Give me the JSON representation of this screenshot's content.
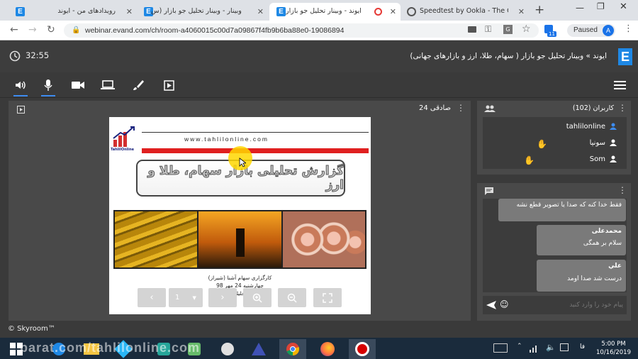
{
  "browser": {
    "tabs": [
      {
        "title": "رویدادهای من - ایوند"
      },
      {
        "title": "وبینار - وبینار تحلیل جو بازار (س"
      },
      {
        "title": "ایوند - وبینار تحلیل جو بازار"
      },
      {
        "title": "Speedtest by Ookla - The Glo"
      }
    ],
    "url": "webinar.evand.com/ch/room-a4060015c00d7a09867f4fb9b6ba88e0-19086894",
    "paused_label": "Paused",
    "profile_initial": "A",
    "ext_badge": "11"
  },
  "app": {
    "timer": "32:55",
    "title": "ایوند » وبینار تحلیل جو بازار ( سهام، طلا، ارز و بازارهای جهانی)",
    "presenter_label": "صادقی 24",
    "footer": "© Skyroom™"
  },
  "users": {
    "header": "کاربران (102)",
    "list": [
      {
        "name": "tahlilonline"
      },
      {
        "name": "سونیا"
      },
      {
        "name": "Som"
      }
    ]
  },
  "chat": {
    "messages": [
      {
        "author": "",
        "text": "فقط خدا کنه که صدا یا تصویر قطع نشه"
      },
      {
        "author": "محمدعلی",
        "text": "سلام بر همگی"
      },
      {
        "author": "علي",
        "text": "درست شد صدا اومد"
      }
    ],
    "input_placeholder": "پیام خود را وارد کنید"
  },
  "slide": {
    "website": "www.tahlilonline.com",
    "heading": "گزارش تحلیلی بازار سهام، طلا و ارز",
    "caption1": "کارگزاری سهام آشنا (شیراز)",
    "caption2": "چهارشنبه 24 مهر 98",
    "caption3": "صادقی (تحلیلگر بنیادی)",
    "logo_text": "TahlilOnline",
    "page": "1"
  },
  "taskbar": {
    "watermark": "parat.com/tahlilonline.com",
    "time": "5:00 PM",
    "date": "10/16/2019",
    "lang": "فا"
  },
  "colors": {
    "accent": "#1e88e5",
    "red_bar": "#e02020"
  }
}
